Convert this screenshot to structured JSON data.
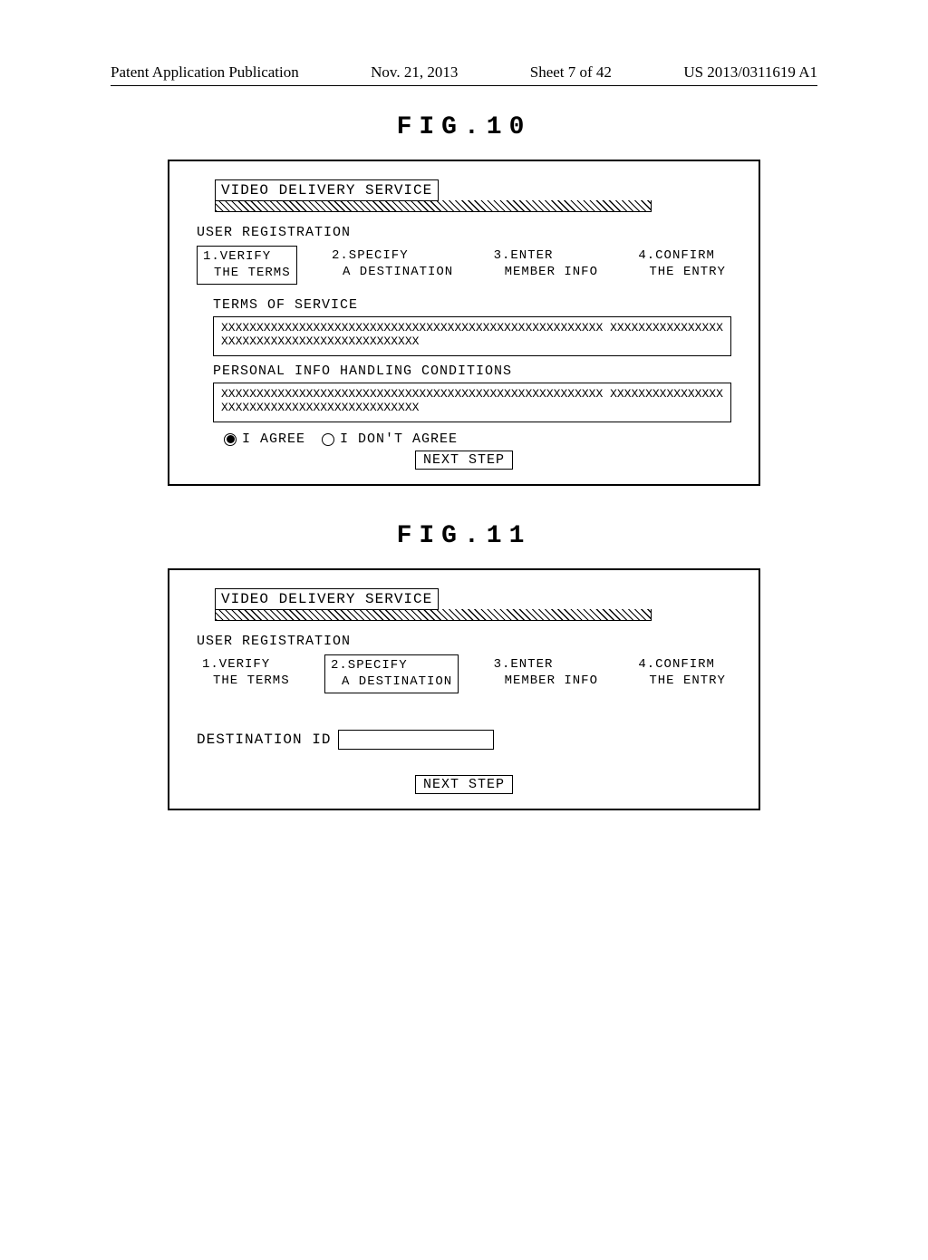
{
  "header": {
    "left": "Patent Application Publication",
    "date": "Nov. 21, 2013",
    "sheet": "Sheet 7 of 42",
    "pubno": "US 2013/0311619 A1"
  },
  "fig10": {
    "label": "FIG.10",
    "banner_title": "VIDEO DELIVERY SERVICE",
    "section": "USER REGISTRATION",
    "steps": [
      {
        "line1": "1.VERIFY",
        "line2": "THE TERMS",
        "selected": true
      },
      {
        "line1": "2.SPECIFY",
        "line2": "A DESTINATION",
        "selected": false
      },
      {
        "line1": "3.ENTER",
        "line2": "MEMBER INFO",
        "selected": false
      },
      {
        "line1": "4.CONFIRM",
        "line2": "THE ENTRY",
        "selected": false
      }
    ],
    "terms_heading": "TERMS OF SERVICE",
    "terms_body": "XXXXXXXXXXXXXXXXXXXXXXXXXXXXXXXXXXXXXXXXXXXXXXXXXXXXXX XXXXXXXXXXXXXXXXXXXXXXXXXXXXXXXXXXXXXXXXXXXX",
    "pi_heading": "PERSONAL INFO HANDLING CONDITIONS",
    "pi_body": "XXXXXXXXXXXXXXXXXXXXXXXXXXXXXXXXXXXXXXXXXXXXXXXXXXXXXX XXXXXXXXXXXXXXXXXXXXXXXXXXXXXXXXXXXXXXXXXXXX",
    "agree_label": "I AGREE",
    "disagree_label": "I DON'T AGREE",
    "agree_selected": true,
    "next_label": "NEXT STEP"
  },
  "fig11": {
    "label": "FIG.11",
    "banner_title": "VIDEO DELIVERY SERVICE",
    "section": "USER REGISTRATION",
    "steps": [
      {
        "line1": "1.VERIFY",
        "line2": "THE TERMS",
        "selected": false
      },
      {
        "line1": "2.SPECIFY",
        "line2": "A DESTINATION",
        "selected": true
      },
      {
        "line1": "3.ENTER",
        "line2": "MEMBER INFO",
        "selected": false
      },
      {
        "line1": "4.CONFIRM",
        "line2": "THE ENTRY",
        "selected": false
      }
    ],
    "dest_label": "DESTINATION ID",
    "dest_value": "",
    "next_label": "NEXT STEP"
  }
}
